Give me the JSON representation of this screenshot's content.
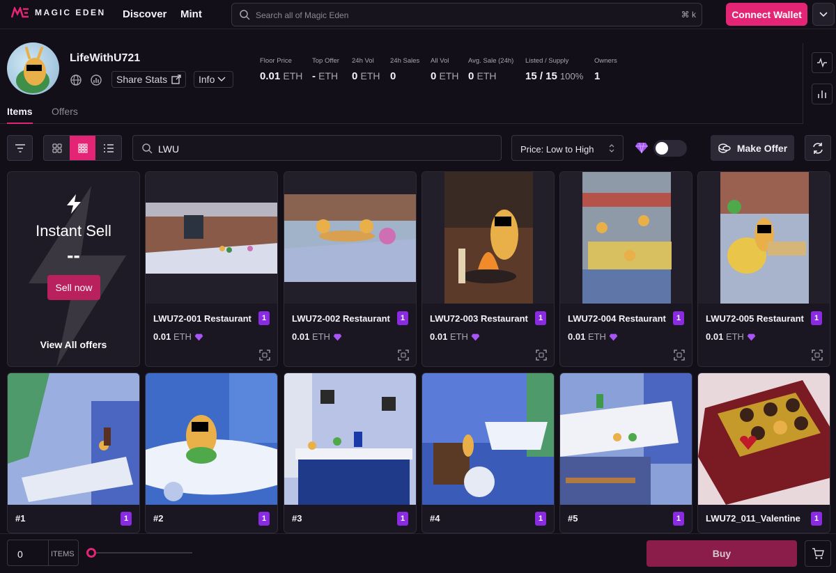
{
  "nav": {
    "logo_text": "MAGIC EDEN",
    "links": [
      "Discover",
      "Mint"
    ],
    "search_placeholder": "Search all of Magic Eden",
    "shortcut": "⌘ k",
    "connect_label": "Connect Wallet"
  },
  "collection": {
    "name": "LifeWithU721",
    "share_label": "Share Stats",
    "info_label": "Info",
    "stats": [
      {
        "label": "Floor Price",
        "value": "0.01",
        "unit": "ETH"
      },
      {
        "label": "Top Offer",
        "value": "-",
        "unit": "ETH"
      },
      {
        "label": "24h Vol",
        "value": "0",
        "unit": "ETH"
      },
      {
        "label": "24h Sales",
        "value": "0",
        "unit": ""
      },
      {
        "label": "All Vol",
        "value": "0",
        "unit": "ETH"
      },
      {
        "label": "Avg. Sale (24h)",
        "value": "0",
        "unit": "ETH"
      },
      {
        "label": "Listed / Supply",
        "value": "15 / 15",
        "unit": "100%"
      },
      {
        "label": "Owners",
        "value": "1",
        "unit": ""
      }
    ]
  },
  "tabs": [
    "Items",
    "Offers"
  ],
  "toolbar": {
    "filter_value": "LWU",
    "sort_label": "Price: Low to High",
    "make_offer_label": "Make Offer"
  },
  "instant_sell": {
    "title": "Instant Sell",
    "value": "--",
    "sell_label": "Sell now",
    "view_label": "View All offers"
  },
  "items_row1": [
    {
      "title": "LWU72-001 Restaurant",
      "badge": "1",
      "price": "0.01",
      "unit": "ETH"
    },
    {
      "title": "LWU72-002 Restaurant",
      "badge": "1",
      "price": "0.01",
      "unit": "ETH"
    },
    {
      "title": "LWU72-003 Restaurant",
      "badge": "1",
      "price": "0.01",
      "unit": "ETH"
    },
    {
      "title": "LWU72-004 Restaurant",
      "badge": "1",
      "price": "0.01",
      "unit": "ETH"
    },
    {
      "title": "LWU72-005 Restaurant",
      "badge": "1",
      "price": "0.01",
      "unit": "ETH"
    }
  ],
  "items_row2": [
    {
      "title": "#1",
      "badge": "1"
    },
    {
      "title": "#2",
      "badge": "1"
    },
    {
      "title": "#3",
      "badge": "1"
    },
    {
      "title": "#4",
      "badge": "1"
    },
    {
      "title": "#5",
      "badge": "1"
    },
    {
      "title": "LWU72_011_Valentine",
      "badge": "1"
    }
  ],
  "bottom": {
    "count": "0",
    "items_label": "ITEMS",
    "buy_label": "Buy"
  },
  "colors": {
    "accent": "#e42575",
    "badge": "#8a2be2",
    "bg": "#120f18"
  }
}
